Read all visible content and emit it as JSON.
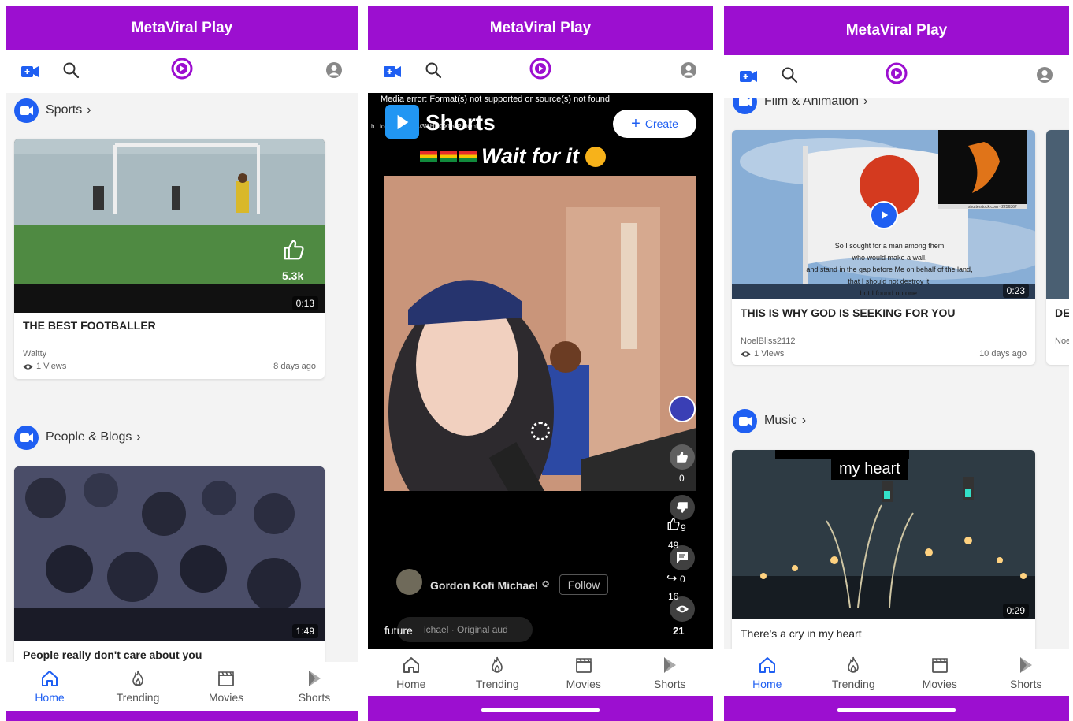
{
  "app_title": "MetaViral Play",
  "tabs": [
    "Home",
    "Trending",
    "Movies",
    "Shorts"
  ],
  "screen1": {
    "categories": [
      "Sports",
      "People & Blogs"
    ],
    "cards": [
      {
        "title": "THE BEST FOOTBALLER",
        "author": "Waltty",
        "views": "1 Views",
        "date": "8 days ago",
        "duration": "0:13",
        "likes": "5.3k"
      },
      {
        "title": "People really don't care about you",
        "duration": "1:49"
      }
    ]
  },
  "screen2": {
    "error_text": "Media error: Format(s) not supported or source(s) not found",
    "url_text": "h...ideos/2023/03/3f6HOCXDwPjviOnB...",
    "shorts_title": "Shorts",
    "create_label": "Create",
    "overlay_caption": "Wait for it",
    "like_count": "0",
    "like_overlay": "9",
    "comment_overlay": "49",
    "share_overlay": "0",
    "views_overlay": "16",
    "views_count": "21",
    "channel_name": "Gordon Kofi Michael",
    "follow_label": "Follow",
    "audio_text": "ichael · Original aud",
    "caption_text": "future"
  },
  "screen3": {
    "categories": [
      "Film & Animation",
      "Music"
    ],
    "cards": [
      {
        "title": "THIS IS WHY GOD IS SEEKING FOR YOU",
        "author": "NoelBliss2112",
        "views": "1 Views",
        "date": "10 days ago",
        "duration": "0:23",
        "overlay_lines": [
          "So I sought for a man among them",
          "who would make a wall,",
          "and stand in the gap before Me on behalf of the land,",
          "that I should not destroy it;",
          "but I found no one."
        ],
        "watermark": "shutterstock.com · 2256367"
      },
      {
        "title": "There's a cry in my heart",
        "duration": "0:29",
        "overlay_caption": "my heart"
      }
    ],
    "partial_card": {
      "title": "DE",
      "author": "Noe"
    }
  },
  "colors": {
    "brand": "#9c0fd0",
    "accent": "#1f5ff2"
  },
  "icons": [
    "video-camera-icon",
    "search-icon",
    "logo-icon",
    "account-icon",
    "home-icon",
    "trending-icon",
    "movies-icon",
    "shorts-icon",
    "like-icon",
    "dislike-icon",
    "comment-icon",
    "eye-icon",
    "share-icon",
    "plus-icon",
    "verified-icon"
  ]
}
